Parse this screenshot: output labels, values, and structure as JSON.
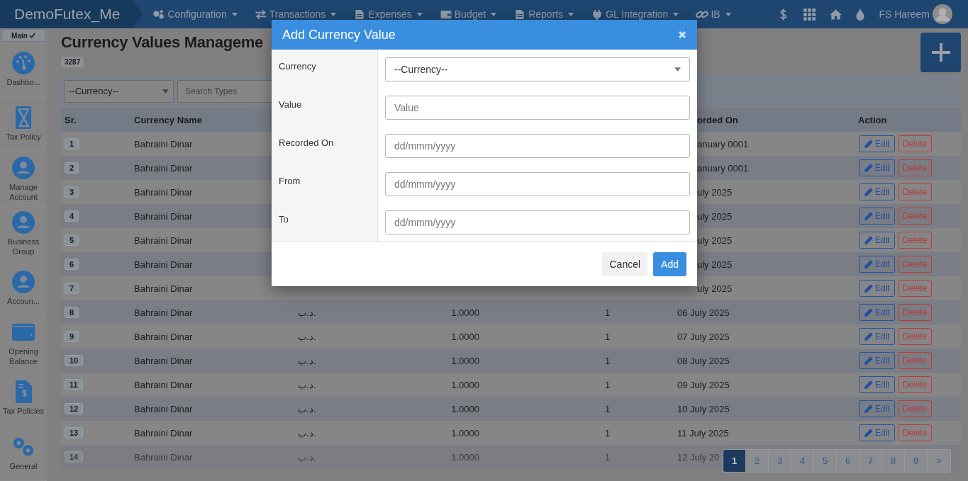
{
  "navbar": {
    "brand": "DemoFutex_Me",
    "menus": [
      {
        "label": "Configuration"
      },
      {
        "label": "Transactions"
      },
      {
        "label": "Expenses"
      },
      {
        "label": "Budget"
      },
      {
        "label": "Reports"
      },
      {
        "label": "GL Integration"
      },
      {
        "label": "IB"
      }
    ],
    "user": "FS Hareem"
  },
  "sidebar": {
    "badge": "Main",
    "items": [
      {
        "label": "Dashbo..."
      },
      {
        "label": "Tax Policy"
      },
      {
        "label": "Manage Account"
      },
      {
        "label": "Business Group"
      },
      {
        "label": "Accoun..."
      },
      {
        "label": "Opening Balance"
      },
      {
        "label": "Tax Policies"
      },
      {
        "label": "General"
      }
    ]
  },
  "page": {
    "title": "Currency Values Manageme",
    "count": "3287"
  },
  "filters": {
    "currency": "--Currency--",
    "search_placeholder": "Search Types"
  },
  "table": {
    "header": {
      "sr": "Sr.",
      "currency_name": "Currency Name",
      "recorded_on": "orded On",
      "action": "Action"
    },
    "rows": [
      {
        "sr": "1",
        "currency_name": "Bahraini Dinar",
        "recorded_on": "anuary 0001",
        "edit": "Edit",
        "delete": "Delete",
        "faded": false
      },
      {
        "sr": "2",
        "currency_name": "Bahraini Dinar",
        "recorded_on": "anuary 0001",
        "edit": "Edit",
        "delete": "Delete",
        "faded": false
      },
      {
        "sr": "3",
        "currency_name": "Bahraini Dinar",
        "recorded_on": "uly 2025",
        "edit": "Edit",
        "delete": "Delete",
        "faded": false
      },
      {
        "sr": "4",
        "currency_name": "Bahraini Dinar",
        "recorded_on": "uly 2025",
        "edit": "Edit",
        "delete": "Delete",
        "faded": false
      },
      {
        "sr": "5",
        "currency_name": "Bahraini Dinar",
        "recorded_on": "uly 2025",
        "edit": "Edit",
        "delete": "Delete",
        "faded": false
      },
      {
        "sr": "6",
        "currency_name": "Bahraini Dinar",
        "recorded_on": "uly 2025",
        "edit": "Edit",
        "delete": "Delete",
        "faded": false
      },
      {
        "sr": "7",
        "currency_name": "Bahraini Dinar",
        "recorded_on": "uly 2025",
        "edit": "Edit",
        "delete": "Delete",
        "faded": false
      },
      {
        "sr": "8",
        "currency_name": "Bahraini Dinar",
        "column_3": "د.ب.",
        "column_4": "1.0000",
        "column_5": "1",
        "recorded_on": "06 July 2025",
        "edit": "Edit",
        "delete": "Delete",
        "faded": false
      },
      {
        "sr": "9",
        "currency_name": "Bahraini Dinar",
        "column_3": "د.ب.",
        "column_4": "1.0000",
        "column_5": "1",
        "recorded_on": "07 July 2025",
        "edit": "Edit",
        "delete": "Delete",
        "faded": false
      },
      {
        "sr": "10",
        "currency_name": "Bahraini Dinar",
        "column_3": "د.ب.",
        "column_4": "1.0000",
        "column_5": "1",
        "recorded_on": "08 July 2025",
        "edit": "Edit",
        "delete": "Delete",
        "faded": false
      },
      {
        "sr": "11",
        "currency_name": "Bahraini Dinar",
        "column_3": "د.ب.",
        "column_4": "1.0000",
        "column_5": "1",
        "recorded_on": "09 July 2025",
        "edit": "Edit",
        "delete": "Delete",
        "faded": false
      },
      {
        "sr": "12",
        "currency_name": "Bahraini Dinar",
        "column_3": "د.ب.",
        "column_4": "1.0000",
        "column_5": "1",
        "recorded_on": "10 July 2025",
        "edit": "Edit",
        "delete": "Delete",
        "faded": false
      },
      {
        "sr": "13",
        "currency_name": "Bahraini Dinar",
        "column_3": "د.ب.",
        "column_4": "1.0000",
        "column_5": "1",
        "recorded_on": "11 July 2025",
        "edit": "Edit",
        "delete": "Delete",
        "faded": false
      },
      {
        "sr": "14",
        "currency_name": "Bahraini Dinar",
        "column_3": "د.ب.",
        "column_4": "1.0000",
        "column_5": "1",
        "recorded_on": "12 July 20",
        "faded": true
      }
    ]
  },
  "pagination": [
    {
      "label": "1",
      "selected": true
    },
    {
      "label": "2",
      "selected": false
    },
    {
      "label": "3",
      "selected": false
    },
    {
      "label": "4",
      "selected": false
    },
    {
      "label": "5",
      "selected": false
    },
    {
      "label": "6",
      "selected": false
    },
    {
      "label": "7",
      "selected": false
    },
    {
      "label": "8",
      "selected": false
    },
    {
      "label": "9",
      "selected": false
    },
    {
      "label": ">",
      "selected": false
    }
  ],
  "modal": {
    "title": "Add Currency Value",
    "fields": [
      {
        "label": "Currency",
        "kind": "select",
        "value": "--Currency--"
      },
      {
        "label": "Value",
        "kind": "input",
        "placeholder": "Value"
      },
      {
        "label": "Recorded On",
        "kind": "input",
        "placeholder": "dd/mmm/yyyy"
      },
      {
        "label": "From",
        "kind": "input",
        "placeholder": "dd/mmm/yyyy"
      },
      {
        "label": "To",
        "kind": "input",
        "placeholder": "dd/mmm/yyyy"
      }
    ],
    "buttons": {
      "cancel": "Cancel",
      "add": "Add"
    }
  }
}
